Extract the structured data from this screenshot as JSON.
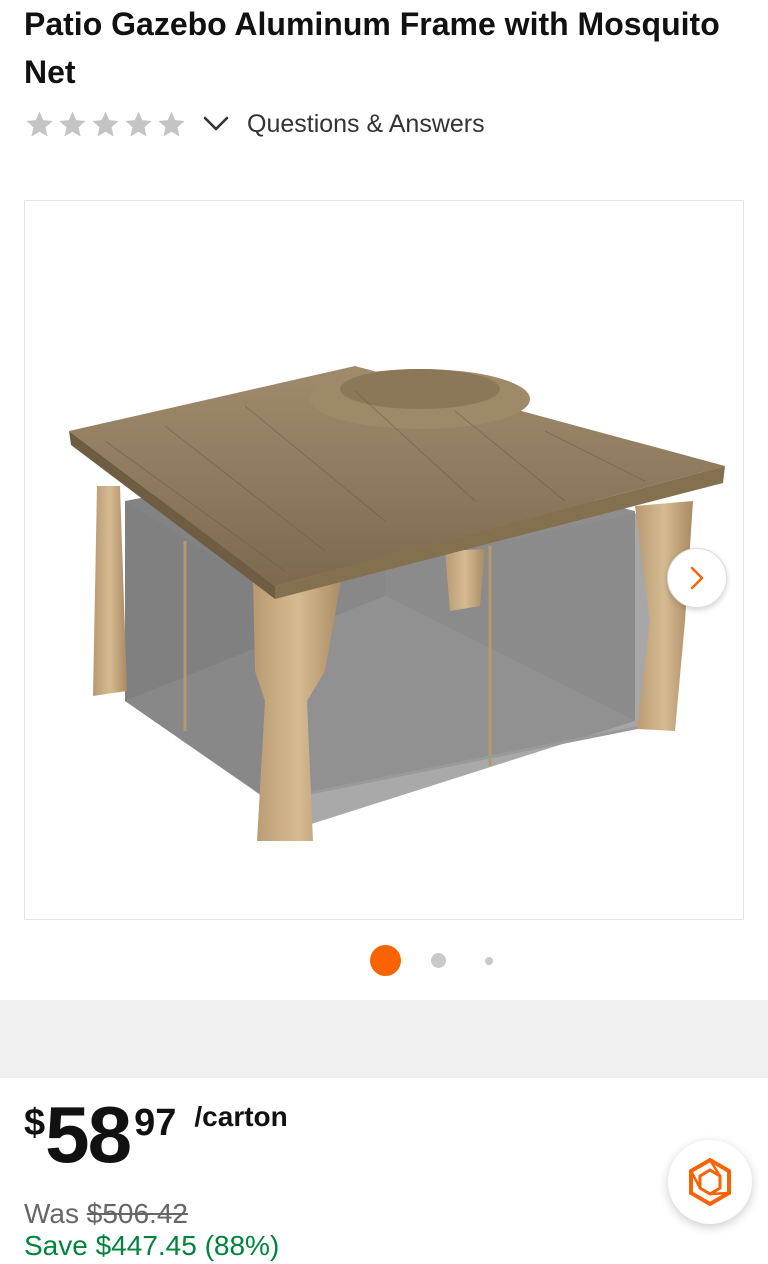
{
  "product": {
    "title": "Patio Gazebo Aluminum Frame with Mosquito Net"
  },
  "rating": {
    "stars_filled": 0,
    "stars_total": 5,
    "qa_label": "Questions & Answers"
  },
  "gallery": {
    "current_index": 1,
    "total": 3
  },
  "pricing": {
    "currency": "$",
    "dollars": "58",
    "cents": "97",
    "unit": "/carton",
    "was_label": "Was",
    "was_price": "$506.42",
    "save_text": "Save $447.45 (88%)"
  },
  "colors": {
    "accent": "#f96302",
    "save_green": "#00843d",
    "star_gray": "#c4c4c4"
  },
  "icons": {
    "stars": "star-icon",
    "expand": "chevron-down-icon",
    "next": "chevron-right-icon",
    "assistant": "hexagon-assistant-icon"
  }
}
